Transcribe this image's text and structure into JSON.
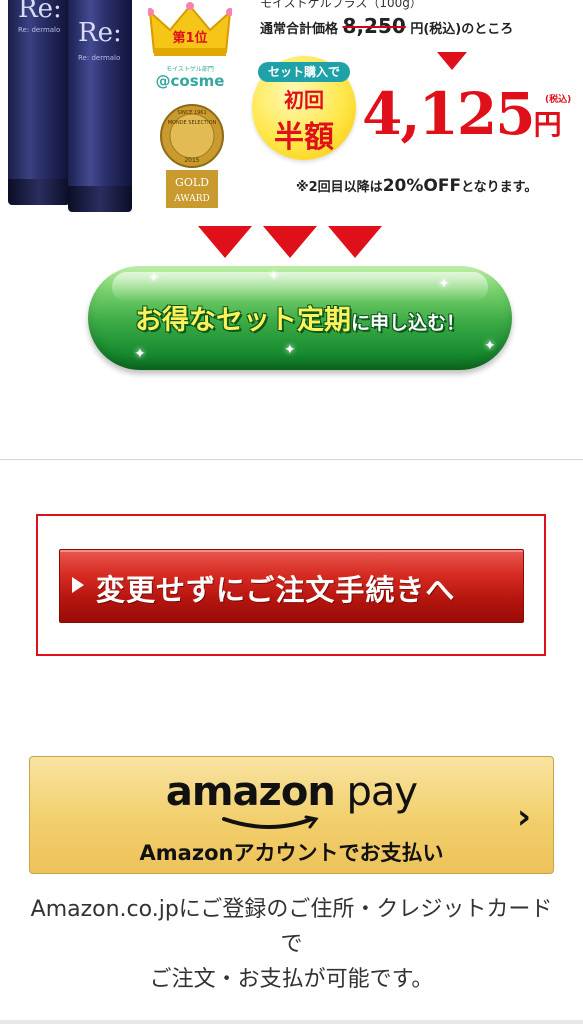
{
  "promo": {
    "product_logo": "Re:",
    "product_sub": "Re: dermalo",
    "award_rank": "第1位",
    "award_category": "モイストゲル部門",
    "cosme_brand": "@cosme",
    "medal_top": "SINCE 1961",
    "medal_name": "MONDE SELECTION",
    "medal_year": "2015",
    "medal_label_1": "GOLD",
    "medal_label_2": "AWARD",
    "product_name": "モイストゲルプラス（100g）",
    "regular_label": "通常合計価格",
    "regular_price": "8,250",
    "regular_suffix": "円(税込)のところ",
    "set_tag": "セット購入で",
    "first_time": "初回",
    "half_price": "半額",
    "price": "4,125",
    "yen": "円",
    "tax": "(税込)",
    "note_prefix": "※2回目以降は",
    "note_discount": "20%OFF",
    "note_suffix": "となります。",
    "cta_main": "お得なセット定期",
    "cta_sub": "に申し込む！"
  },
  "order": {
    "button_label": "変更せずにご注文手続きへ"
  },
  "amazon_pay": {
    "logo_main": "amazon",
    "logo_pay": " pay",
    "subtitle": "Amazonアカウントでお支払い",
    "chevron": "›",
    "note_line1": "Amazon.co.jpにご登録のご住所・クレジットカード",
    "note_line2": "で",
    "note_line3": "ご注文・お支払が可能です。"
  },
  "colors": {
    "accent_red": "#e0101b",
    "green_button": "#3aa945",
    "amazon_gold": "#f2cf6c"
  }
}
